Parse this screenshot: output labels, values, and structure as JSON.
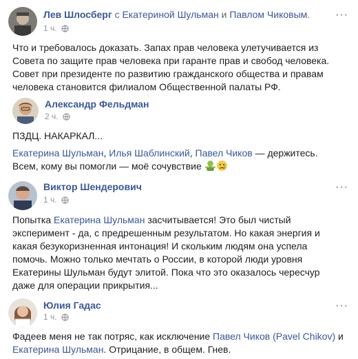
{
  "posts": [
    {
      "author": "Лев Шлосберг",
      "with_word": "с",
      "tag1": "Екатериной Шульман",
      "and_word": "и",
      "tag2": "Павлом Чиковым",
      "period": ".",
      "time": "1 ч.",
      "more": "···",
      "text": "Что и требовалось доказать. Запах прав человека улетучивается из Совета по защите прав человека при гаранте прав и свобод человека. Совет при президенте по развитию гражданского общества и правам человека становится филиалом Общественной палаты РФ."
    },
    {
      "author": "Александр Фельдман",
      "time": "2 ч.",
      "line1": "ПЗДЦ. НАКАРКАЛ...",
      "mentions": [
        "Екатерина Шульман",
        "Илья Шаблинский",
        "Павел Чиков"
      ],
      "sep": ", ",
      "tail": " — держитесь. Всем, кому вы помогли — моё сочувствие"
    },
    {
      "author": "Виктор Шендерович",
      "time": "1 ч.",
      "more": "···",
      "text_a": "Попытка ",
      "mention": "Екатерина Шульман",
      "text_b": " засчитывается! Это был чистый эксперимент - да, с предрешенным результатом. Но какая энергия и какая безукоризненная интонация! И скольким людям она успела помочь. Можно только мечтать о России, в которой люди уровня Екатерины Шульман будут элитой. Пока что это оказалось чересчур даже для операции прикрытия..."
    },
    {
      "author": "Юлия Гадас",
      "time": "1 ч.",
      "more": "···",
      "text_a": "Фадеев меня не так потряс, как исключение ",
      "mention1": "Павел Чиков (Pavel Chikov)",
      "text_b": " и ",
      "mention2": "Екатерина Шульман",
      "text_c": ". Отрицание, в общем. Гнев."
    }
  ],
  "icons": {
    "globe": "globe-icon",
    "more": "more-options-icon",
    "emoji1": "zombie-emoji",
    "emoji2": "sad-face-emoji"
  },
  "colors": {
    "link": "#385898",
    "meta": "#90949c",
    "text": "#1c1e21"
  }
}
